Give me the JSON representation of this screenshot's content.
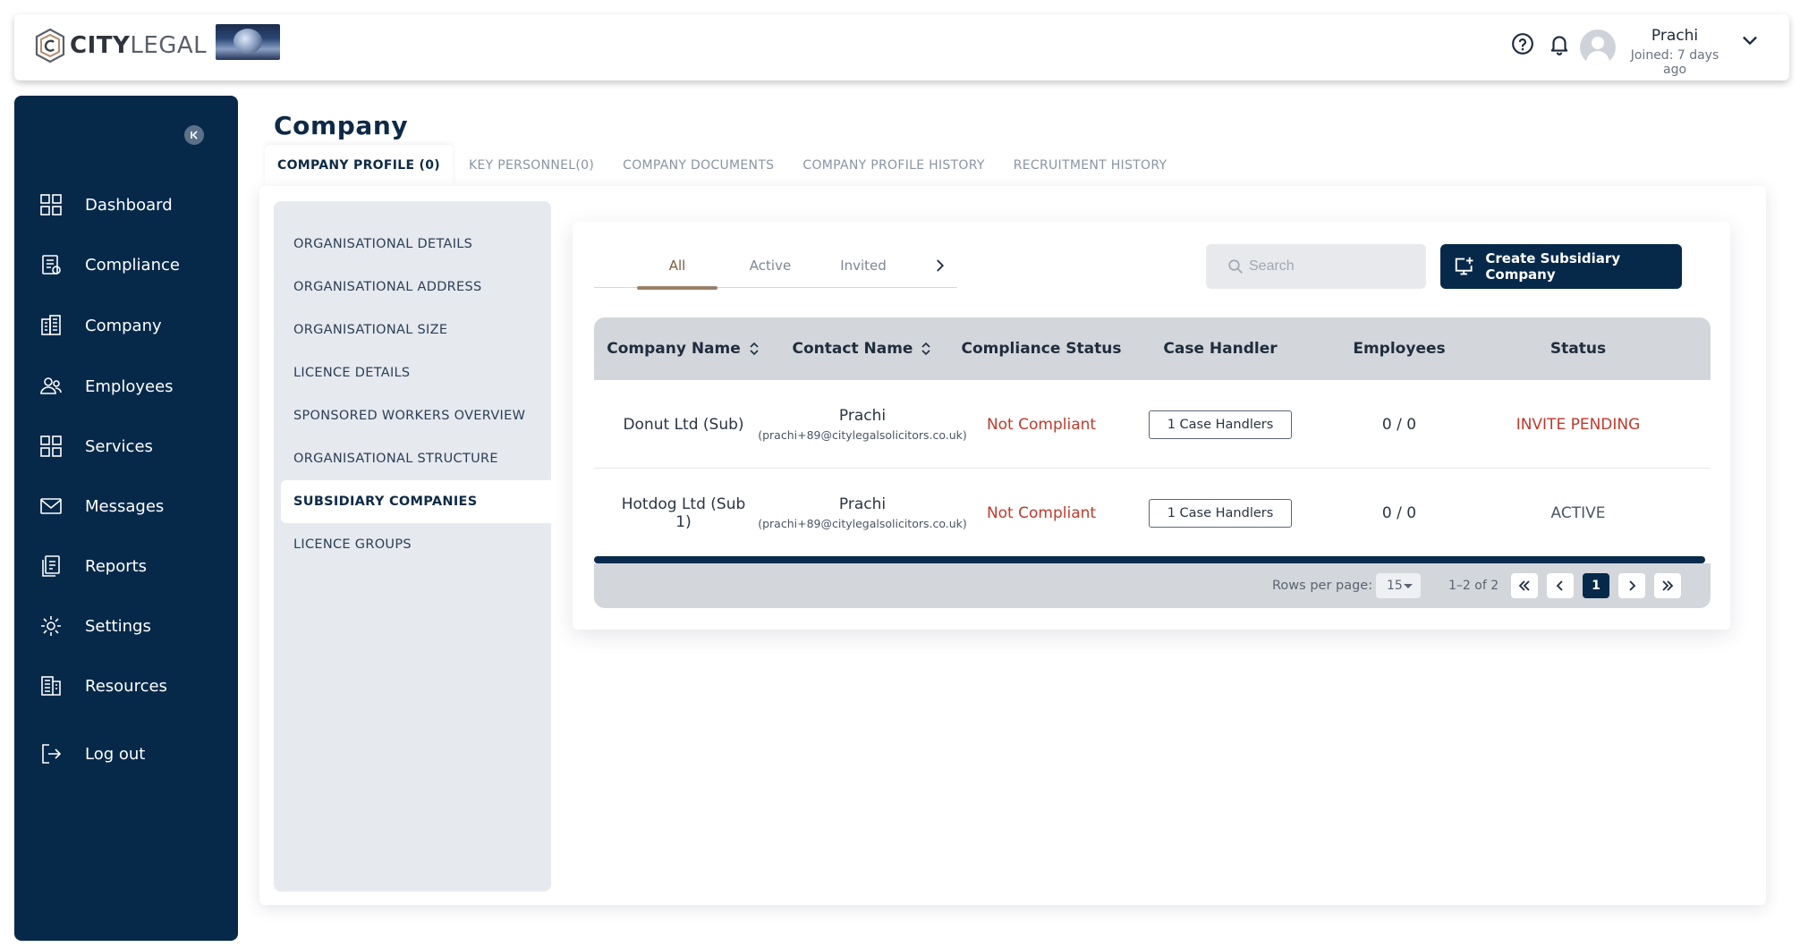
{
  "header": {
    "logo_bold": "CITY",
    "logo_light": "LEGAL",
    "user_name": "Prachi",
    "user_joined": "Joined: 7 days ago"
  },
  "sidebar": {
    "items": [
      {
        "label": "Dashboard",
        "icon": "dashboard-icon"
      },
      {
        "label": "Compliance",
        "icon": "compliance-icon"
      },
      {
        "label": "Company",
        "icon": "company-icon"
      },
      {
        "label": "Employees",
        "icon": "employees-icon"
      },
      {
        "label": "Services",
        "icon": "services-icon"
      },
      {
        "label": "Messages",
        "icon": "messages-icon"
      },
      {
        "label": "Reports",
        "icon": "reports-icon"
      },
      {
        "label": "Settings",
        "icon": "settings-icon"
      },
      {
        "label": "Resources",
        "icon": "resources-icon"
      },
      {
        "label": "Log out",
        "icon": "logout-icon"
      }
    ],
    "active": "Company"
  },
  "page": {
    "title": "Company",
    "tabs": [
      "COMPANY PROFILE (0)",
      "KEY PERSONNEL(0)",
      "COMPANY DOCUMENTS",
      "COMPANY PROFILE HISTORY",
      "RECRUITMENT HISTORY"
    ]
  },
  "subnav": {
    "items": [
      "ORGANISATIONAL DETAILS",
      "ORGANISATIONAL ADDRESS",
      "ORGANISATIONAL SIZE",
      "LICENCE DETAILS",
      "SPONSORED WORKERS OVERVIEW",
      "ORGANISATIONAL STRUCTURE",
      "SUBSIDIARY COMPANIES",
      "LICENCE GROUPS"
    ],
    "active": "SUBSIDIARY COMPANIES"
  },
  "filters": {
    "tabs": [
      "All",
      "Active",
      "Invited"
    ],
    "active": "All"
  },
  "search": {
    "placeholder": "Search"
  },
  "create_button": "Create Subsidiary Company",
  "table": {
    "columns": [
      "Company Name",
      "Contact Name",
      "Compliance Status",
      "Case Handler",
      "Employees",
      "Status"
    ],
    "rows": [
      {
        "company": "Donut Ltd (Sub)",
        "contact_name": "Prachi",
        "contact_email": "(prachi+89@citylegalsolicitors.co.uk)",
        "compliance": "Not Compliant",
        "case_handler": "1 Case Handlers",
        "employees": "0 / 0",
        "status": "INVITE PENDING"
      },
      {
        "company": "Hotdog Ltd (Sub 1)",
        "contact_name": "Prachi",
        "contact_email": "(prachi+89@citylegalsolicitors.co.uk)",
        "compliance": "Not Compliant",
        "case_handler": "1 Case Handlers",
        "employees": "0 / 0",
        "status": "ACTIVE"
      }
    ]
  },
  "pagination": {
    "rows_per_page_label": "Rows per page:",
    "rows_per_page": "15",
    "range": "1–2 of 2",
    "current_page": "1"
  },
  "colors": {
    "navy": "#06294a",
    "accent_brown": "#9a8068",
    "error_red": "#c0392b"
  }
}
